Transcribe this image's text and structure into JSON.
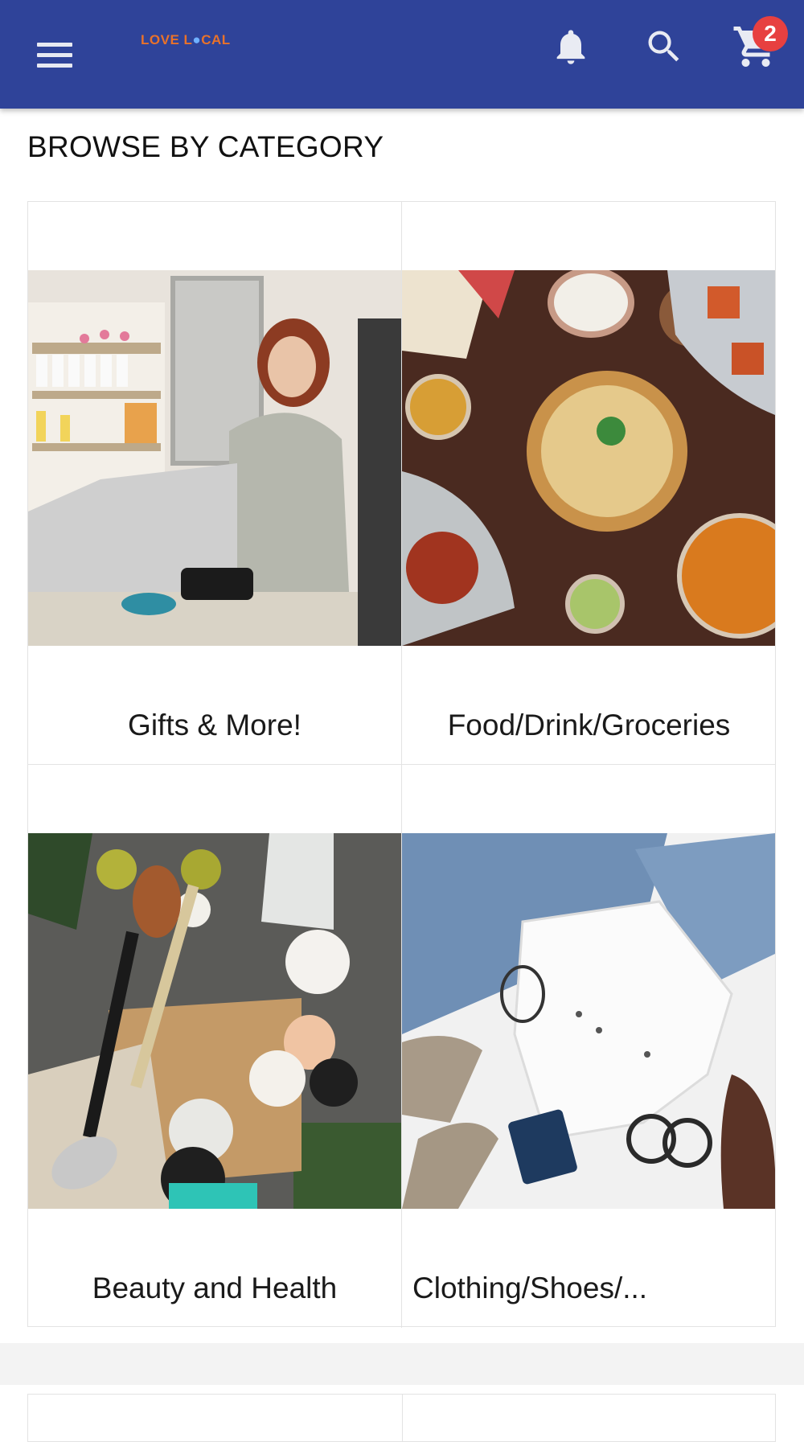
{
  "header": {
    "logo_part1": "LOVE L",
    "logo_part2": "CAL",
    "cart_count": "2",
    "icons": [
      "menu-icon",
      "bell-icon",
      "search-icon",
      "cart-icon"
    ],
    "bar_color": "#2f4399",
    "badge_color": "#e74040"
  },
  "section": {
    "title": "BROWSE BY CATEGORY"
  },
  "categories": [
    {
      "label": "Gifts & More!"
    },
    {
      "label": "Food/Drink/Groceries"
    },
    {
      "label": "Beauty and Health"
    },
    {
      "label": "Clothing/Shoes/..."
    }
  ]
}
